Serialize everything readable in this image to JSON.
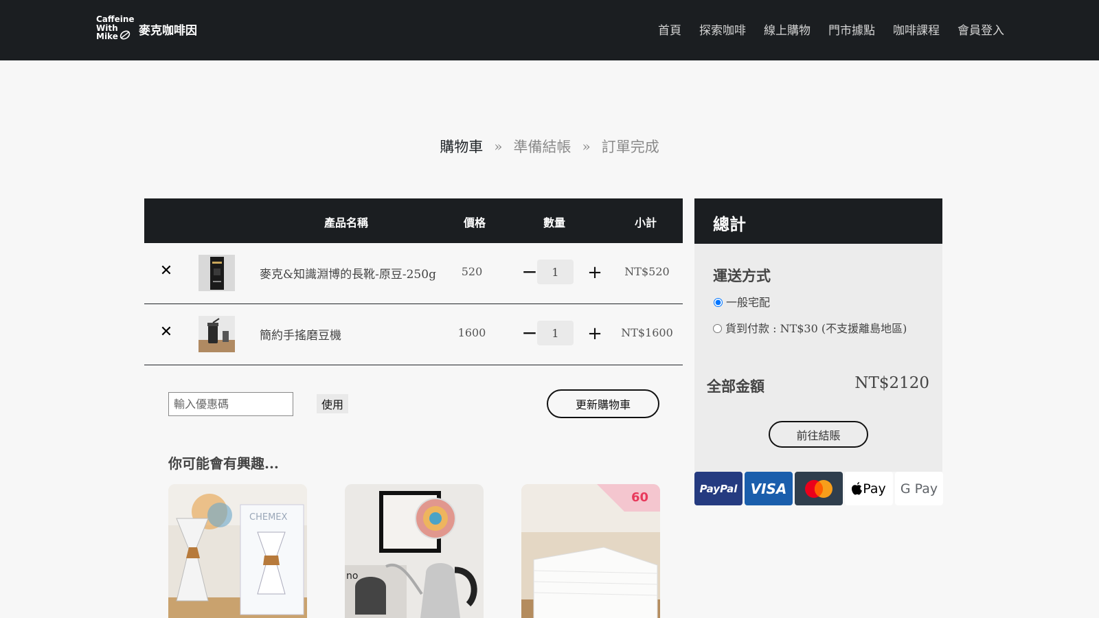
{
  "brand": {
    "logo_text": [
      "Caffeine",
      "With",
      "Mike"
    ],
    "name": "麥克咖啡因"
  },
  "nav": [
    "首頁",
    "探索咖啡",
    "線上購物",
    "門市據點",
    "咖啡課程",
    "會員登入"
  ],
  "steps": {
    "items": [
      "購物車",
      "準備結帳",
      "訂單完成"
    ],
    "separator": "»",
    "active": 0
  },
  "cart": {
    "headers": {
      "name": "產品名稱",
      "price": "價格",
      "qty": "數量",
      "subtotal": "小計"
    },
    "rows": [
      {
        "name": "麥克&知識淵博的長靴-原豆-250g",
        "price": "520",
        "qty": "1",
        "subtotal": "NT$520",
        "remove": "✕",
        "minus": "−",
        "plus": "+",
        "thumb_icon": "coffee-bag"
      },
      {
        "name": "簡約手搖磨豆機",
        "price": "1600",
        "qty": "1",
        "subtotal": "NT$1600",
        "remove": "✕",
        "minus": "−",
        "plus": "+",
        "thumb_icon": "grinder"
      }
    ],
    "coupon_placeholder": "輸入優惠碼",
    "use_label": "使用",
    "update_label": "更新購物車"
  },
  "recommendations": {
    "title": "你可能會有興趣...",
    "items": [
      {
        "image": "chemex",
        "box_text": "CHEMEX"
      },
      {
        "image": "kettle",
        "box_text": "no"
      },
      {
        "image": "filter-papers",
        "box_text": "60"
      }
    ]
  },
  "summary": {
    "title": "總計",
    "shipping_title": "運送方式",
    "options": [
      {
        "label": "一般宅配",
        "checked": true
      },
      {
        "label": "貨到付款 : NT$30 (不支援離島地區)",
        "checked": false
      }
    ],
    "total_label": "全部金額",
    "total_value": "NT$2120",
    "checkout_label": "前往結賬"
  },
  "payments": [
    {
      "name": "PayPal",
      "bg": "#253b80",
      "fg": "#ffffff"
    },
    {
      "name": "VISA",
      "bg": "#1a5eac",
      "fg": "#ffffff"
    },
    {
      "name": "mastercard",
      "bg": "#2f3e4d",
      "fg": "#ffffff"
    },
    {
      "name": "Pay",
      "bg": "#ffffff",
      "fg": "#000000"
    },
    {
      "name": "G Pay",
      "bg": "#ffffff",
      "fg": "#5f6368"
    }
  ],
  "colors": {
    "dark": "#1b1e21",
    "background": "#f7f7f7",
    "summary_bg": "#ececec"
  }
}
